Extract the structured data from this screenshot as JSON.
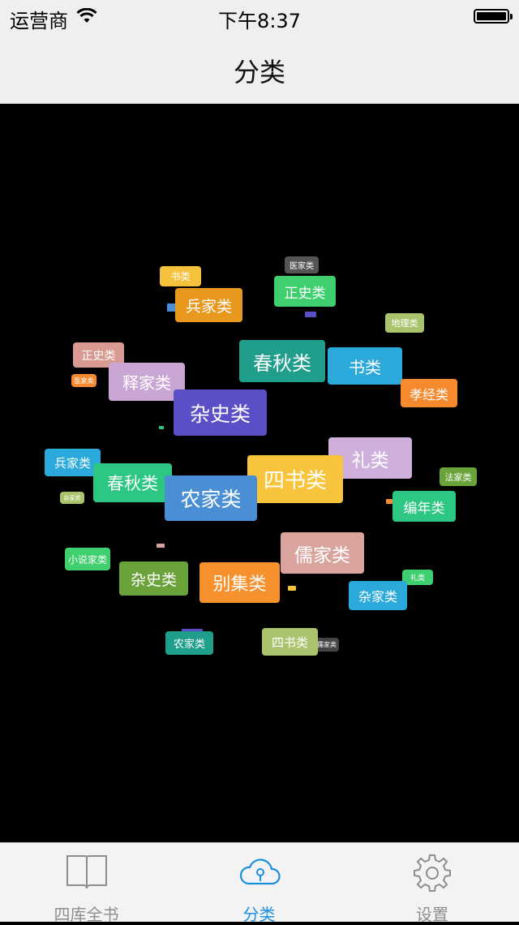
{
  "status_bar": {
    "carrier": "运营商",
    "time": "下午8:37"
  },
  "nav": {
    "title": "分类"
  },
  "cloud_tags": [
    {
      "label": "书类",
      "color": "#f6c23e"
    },
    {
      "label": "兵家类",
      "color": "#e8981c"
    },
    {
      "label": "医家类",
      "color": "#555555"
    },
    {
      "label": "正史类",
      "color": "#3fcf6f"
    },
    {
      "label": "地理类",
      "color": "#a9c46c"
    },
    {
      "label": "正史类",
      "color": "#d89a93"
    },
    {
      "label": "春秋类",
      "color": "#1f9e8c"
    },
    {
      "label": "书类",
      "color": "#2aa9da"
    },
    {
      "label": "释家类",
      "color": "#c9a6d4"
    },
    {
      "label": "孝经类",
      "color": "#f58b2e"
    },
    {
      "label": "医家类",
      "color": "#f58b2e"
    },
    {
      "label": "杂史类",
      "color": "#5a4fc6"
    },
    {
      "label": "礼类",
      "color": "#cfb0dd"
    },
    {
      "label": "兵家类",
      "color": "#2aa9da"
    },
    {
      "label": "春秋类",
      "color": "#2cc782"
    },
    {
      "label": "四书类",
      "color": "#f7c43c"
    },
    {
      "label": "法家类",
      "color": "#6aa33a"
    },
    {
      "label": "农家类",
      "color": "#4a8fd6"
    },
    {
      "label": "编年类",
      "color": "#2cc782"
    },
    {
      "label": "儒家类",
      "color": "#d8a49d"
    },
    {
      "label": "小说家类",
      "color": "#3fcf6f"
    },
    {
      "label": "杂史类",
      "color": "#6aa33a"
    },
    {
      "label": "别集类",
      "color": "#f7912d"
    },
    {
      "label": "礼类",
      "color": "#3fcf6f"
    },
    {
      "label": "杂家类",
      "color": "#2aa9da"
    },
    {
      "label": "农家类",
      "color": "#1f9e8c"
    },
    {
      "label": "四书类",
      "color": "#a9c46c"
    },
    {
      "label": "儒家类",
      "color": "#444444"
    },
    {
      "label": "杂家类",
      "color": "#a9c46c"
    }
  ],
  "tabs": [
    {
      "label": "四库全书",
      "icon": "book-icon"
    },
    {
      "label": "分类",
      "icon": "cloud-icon",
      "active": true
    },
    {
      "label": "设置",
      "icon": "gear-icon"
    }
  ]
}
